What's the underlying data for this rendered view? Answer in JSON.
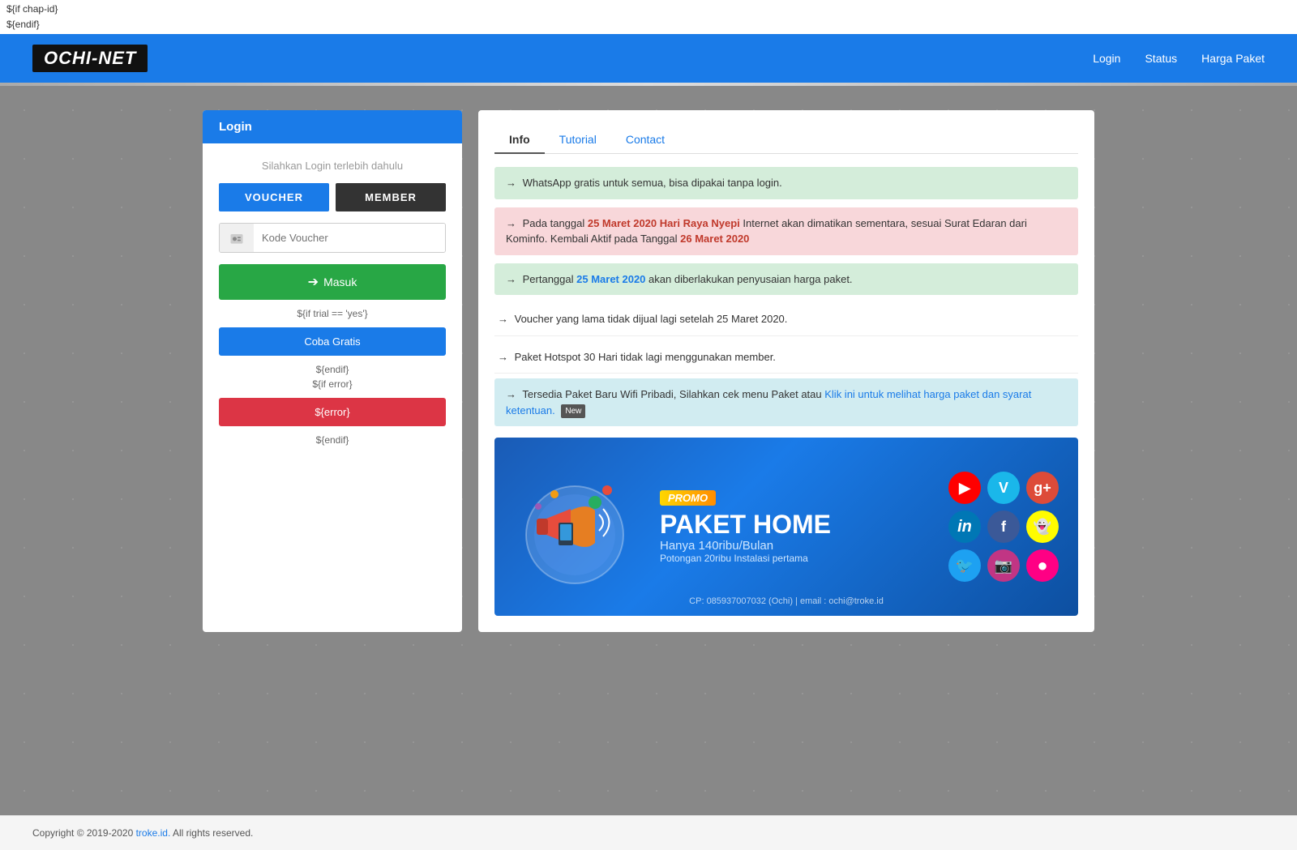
{
  "debug": {
    "line1": "${if chap-id}",
    "line2": "${endif}"
  },
  "header": {
    "logo": "OCHI-NET",
    "nav": {
      "login": "Login",
      "status": "Status",
      "harga_paket": "Harga Paket"
    }
  },
  "login_panel": {
    "title": "Login",
    "hint": "Silahkan Login terlebih dahulu",
    "btn_voucher": "VOUCHER",
    "btn_member": "MEMBER",
    "input_placeholder": "Kode Voucher",
    "btn_masuk": "Masuk",
    "template_trial": "${if trial == 'yes'}",
    "btn_coba": "Coba Gratis",
    "template_endif1": "${endif}",
    "template_error_if": "${if error}",
    "btn_error": "${error}",
    "template_endif2": "${endif}"
  },
  "info_panel": {
    "tabs": [
      {
        "label": "Info",
        "active": true,
        "type": "default"
      },
      {
        "label": "Tutorial",
        "active": false,
        "type": "link"
      },
      {
        "label": "Contact",
        "active": false,
        "type": "link"
      }
    ],
    "messages": [
      {
        "type": "green",
        "arrow": "→",
        "text": "WhatsApp gratis untuk semua, bisa dipakai tanpa login."
      },
      {
        "type": "red",
        "arrow": "→",
        "prefix": "Pada tanggal ",
        "highlight1": "25 Maret 2020 Hari Raya Nyepi",
        "middle": " Internet akan dimatikan sementara, sesuai Surat Edaran dari Kominfo. Kembali Aktif pada Tanggal ",
        "highlight2": "26 Maret 2020",
        "suffix": ""
      },
      {
        "type": "green",
        "arrow": "→",
        "prefix": "Pertanggal ",
        "highlight": "25 Maret 2020",
        "suffix": " akan diberlakukan penyusaian harga paket."
      },
      {
        "type": "plain",
        "arrow": "→",
        "text": "Voucher yang lama tidak dijual lagi setelah 25 Maret 2020."
      },
      {
        "type": "plain",
        "arrow": "→",
        "text": "Paket Hotspot 30 Hari tidak lagi menggunakan member."
      },
      {
        "type": "blue",
        "arrow": "→",
        "prefix": "Tersedia Paket Baru Wifi Pribadi, Silahkan cek menu Paket atau ",
        "link_text": "Klik ini untuk melihat harga paket dan syarat ketentuan.",
        "badge": "New"
      }
    ],
    "promo": {
      "badge": "PROMO",
      "title": "PAKET HOME",
      "subtitle": "Hanya 140ribu/Bulan",
      "cut": "Potongan 20ribu Instalasi pertama",
      "contact": "CP: 085937007032 (Ochi) | email : ochi@troke.id"
    }
  },
  "footer": {
    "text": "Copyright © 2019-2020 ",
    "link_text": "troke.id.",
    "suffix": " All rights reserved."
  }
}
